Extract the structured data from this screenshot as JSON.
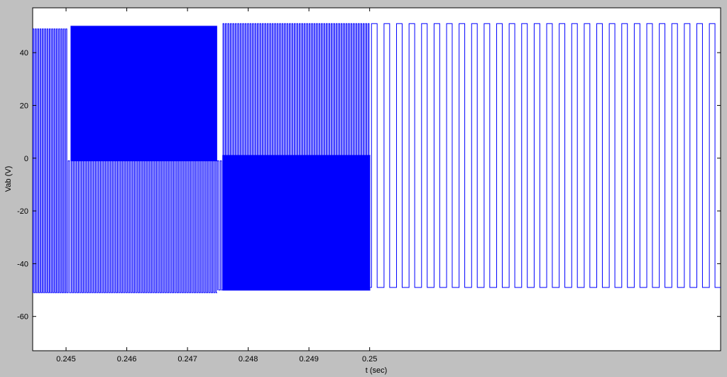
{
  "chart_data": {
    "type": "line",
    "title": "",
    "xlabel": "t (sec)",
    "ylabel": "Vab (V)",
    "xlim": [
      0.24445,
      0.25578
    ],
    "ylim": [
      -73,
      57
    ],
    "xticks": [
      0.245,
      0.246,
      0.247,
      0.248,
      0.249,
      0.25
    ],
    "xtick_labels": [
      "0.245",
      "0.246",
      "0.247",
      "0.248",
      "0.249",
      "0.25"
    ],
    "yticks": [
      40,
      20,
      0,
      -20,
      -40,
      -60
    ],
    "ytick_labels": [
      "40",
      "20",
      "0",
      "-20",
      "-40",
      "-60"
    ],
    "grid": false,
    "series": [
      {
        "color": "#0000ff",
        "segments": [
          {
            "x_start": 0.24445,
            "x_end": 0.24503,
            "level_high": 49,
            "level_low": -51,
            "pulses": 15,
            "density": "sparse"
          },
          {
            "x_start": 0.24503,
            "x_end": 0.24508,
            "level_high": -1,
            "level_low": -51,
            "pulses": 1,
            "density": "sparse"
          },
          {
            "x_start": 0.24508,
            "x_end": 0.24749,
            "level_high": 50,
            "level_low": -1,
            "pulses": 120,
            "density": "dense"
          },
          {
            "x_start": 0.24508,
            "x_end": 0.24749,
            "level_high": -1,
            "level_low": -51,
            "pulses": 60,
            "density": "medium"
          },
          {
            "x_start": 0.24749,
            "x_end": 0.24758,
            "level_high": -1,
            "level_low": -50,
            "pulses": 2,
            "density": "sparse"
          },
          {
            "x_start": 0.24758,
            "x_end": 0.25001,
            "level_high": 51,
            "level_low": 1,
            "pulses": 60,
            "density": "medium"
          },
          {
            "x_start": 0.24758,
            "x_end": 0.25001,
            "level_high": 1,
            "level_low": -50,
            "pulses": 120,
            "density": "dense"
          },
          {
            "x_start": 0.25001,
            "x_end": 0.25578,
            "level_high": 51,
            "level_low": -49,
            "pulses": 28,
            "density": "sparse"
          }
        ]
      }
    ]
  }
}
